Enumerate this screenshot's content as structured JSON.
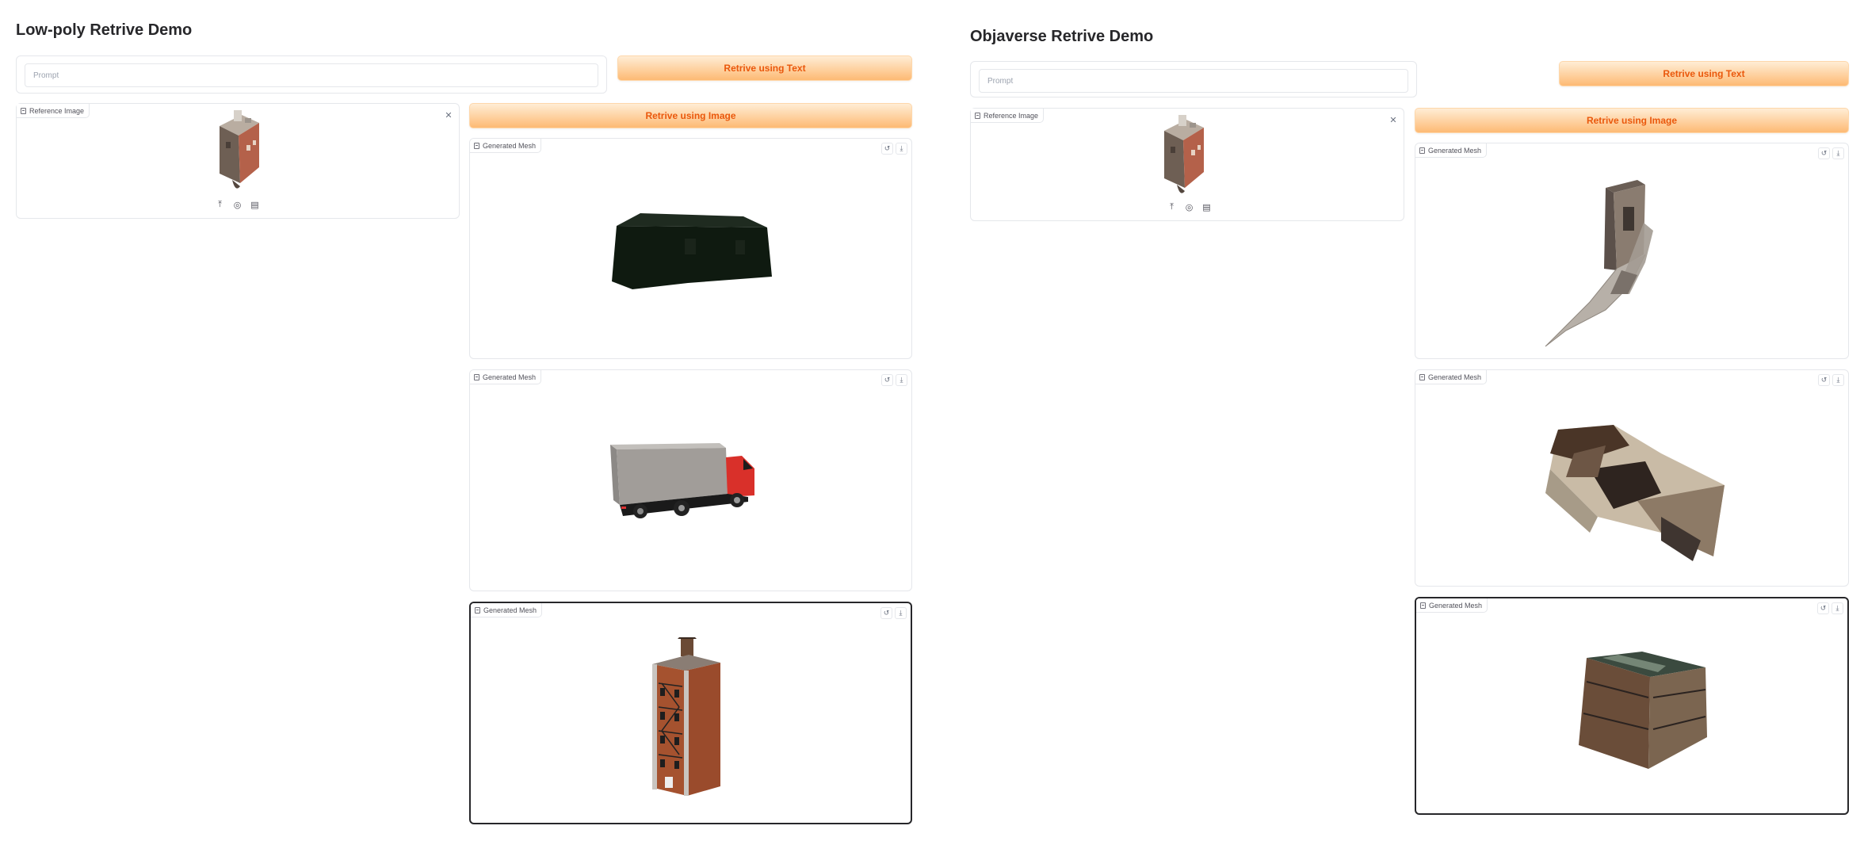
{
  "left": {
    "title": "Low-poly Retrive Demo",
    "prompt_placeholder": "Prompt",
    "text_button": "Retrive using Text",
    "reference_label": "Reference Image",
    "image_button": "Retrive using Image",
    "meshes": [
      {
        "label": "Generated Mesh",
        "object": "dark-green-building"
      },
      {
        "label": "Generated Mesh",
        "object": "box-truck"
      },
      {
        "label": "Generated Mesh",
        "object": "brick-apartment-building"
      }
    ]
  },
  "right": {
    "title": "Objaverse Retrive Demo",
    "prompt_placeholder": "Prompt",
    "text_button": "Retrive using Text",
    "reference_label": "Reference Image",
    "image_button": "Retrive using Image",
    "meshes": [
      {
        "label": "Generated Mesh",
        "object": "scanned-shed-tower"
      },
      {
        "label": "Generated Mesh",
        "object": "scanned-ruined-house"
      },
      {
        "label": "Generated Mesh",
        "object": "scanned-wooden-crate-hut"
      }
    ]
  },
  "icons": {
    "reference": "image-icon",
    "mesh": "file-icon",
    "reset": "undo-icon",
    "download": "download-icon",
    "close": "close-icon",
    "upload": "upload-icon",
    "webcam": "webcam-icon",
    "clipboard": "clipboard-icon"
  },
  "colors": {
    "accent": "#ea580c",
    "button_gradient_top": "#ffedd5",
    "button_gradient_bottom": "#fdba74",
    "border": "#e5e7eb"
  }
}
